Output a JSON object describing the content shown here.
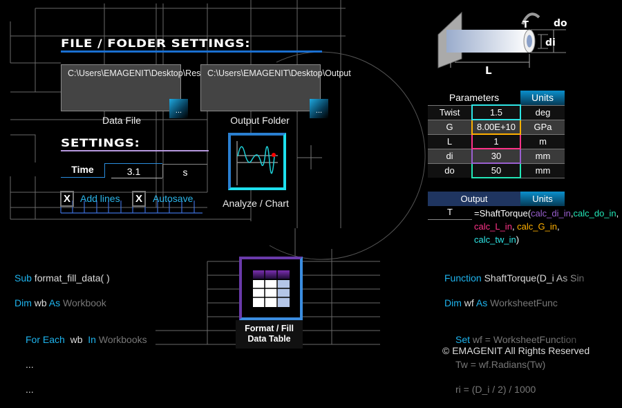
{
  "file_settings": {
    "heading": "FILE / FOLDER SETTINGS:",
    "data_file_path": "C:\\Users\\EMAGENIT\\Desktop\\Results\\Deflection.xlsx",
    "data_file_label": "Data File",
    "output_folder_path": "C:\\Users\\EMAGENIT\\Desktop\\Output",
    "output_folder_label": "Output Folder",
    "browse_label": "..."
  },
  "settings": {
    "heading": "SETTINGS:",
    "time_label": "Time",
    "time_value": "3.1",
    "time_unit": "s",
    "add_lines": {
      "label": "Add lines",
      "mark": "X",
      "checked": true
    },
    "autosave": {
      "label": "Autosave",
      "mark": "X",
      "checked": true
    }
  },
  "analyze": {
    "label": "Analyze / Chart",
    "icon": "wave-chart-icon"
  },
  "format_fill": {
    "label1": "Format / Fill",
    "label2": "Data Table",
    "icon": "table-icon"
  },
  "code_left": {
    "l1a": "Sub",
    "l1b": " format_fill_data( )",
    "l2a": "Dim",
    "l2b": " wb ",
    "l2c": "As",
    "l2d": " Workbook",
    "l3a": "For Each",
    "l3b": "  wb  ",
    "l3c": "In",
    "l3d": " Workbooks",
    "l4": "...",
    "l5": "..."
  },
  "diagram": {
    "T": "T",
    "do": "do",
    "di": "di",
    "L": "L"
  },
  "parameters": {
    "header": "Parameters",
    "units_header": "Units",
    "rows": [
      {
        "name": "Twist",
        "value": "1.5",
        "unit": "deg",
        "color": "#2ee6e6"
      },
      {
        "name": "G",
        "value": "8.00E+10",
        "unit": "GPa",
        "color": "#ffb000"
      },
      {
        "name": "L",
        "value": "1",
        "unit": "m",
        "color": "#ff3388"
      },
      {
        "name": "di",
        "value": "30",
        "unit": "mm",
        "color": "#9a5fd0"
      },
      {
        "name": "do",
        "value": "50",
        "unit": "mm",
        "color": "#22e8b8"
      }
    ]
  },
  "output": {
    "header": "Output",
    "units_header": "Units",
    "name": "T",
    "formula": {
      "f0": "=ShaftTorque(",
      "f1": "calc_di_in",
      "f2": ",",
      "f3": "calc_do_in",
      "f4": ", ",
      "f5": "calc_L_in",
      "f6": ", ",
      "f7": "calc_G_in",
      "f8": ", ",
      "f9": "calc_tw_in",
      "f10": ")"
    }
  },
  "code_right": {
    "l1a": "Function",
    "l1b": " ShaftTorque(D_i As Sin",
    "l2a": "Dim",
    "l2b": " wf ",
    "l2c": "As",
    "l2d": " WorksheetFunc",
    "l3a": "Set",
    "l3b": " wf = WorksheetFunction",
    "l4": "Tw = wf.Radians(Tw)",
    "l5": "ri = (D_i / 2) / 1000"
  },
  "copyright": "© EMAGENIT All Rights Reserved"
}
